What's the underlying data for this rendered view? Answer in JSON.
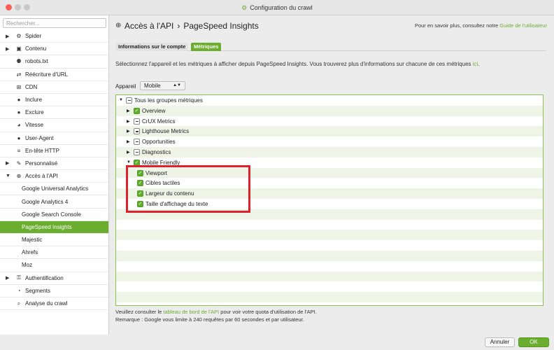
{
  "window": {
    "title": "Configuration du crawl"
  },
  "sidebar": {
    "search_placeholder": "Rechercher...",
    "items": [
      {
        "label": "Spider",
        "caret": "▶",
        "icon": "⚙"
      },
      {
        "label": "Contenu",
        "caret": "▶",
        "icon": "▣"
      },
      {
        "label": "robots.txt",
        "caret": "",
        "icon": "⚉"
      },
      {
        "label": "Réécriture d'URL",
        "caret": "",
        "icon": "⇄"
      },
      {
        "label": "CDN",
        "caret": "",
        "icon": "⊞"
      },
      {
        "label": "Inclure",
        "caret": "",
        "icon": "●"
      },
      {
        "label": "Exclure",
        "caret": "",
        "icon": "●"
      },
      {
        "label": "Vitesse",
        "caret": "",
        "icon": "◕"
      },
      {
        "label": "User-Agent",
        "caret": "",
        "icon": "●"
      },
      {
        "label": "En-tête HTTP",
        "caret": "",
        "icon": "≡"
      },
      {
        "label": "Personnalisé",
        "caret": "▶",
        "icon": "✎"
      },
      {
        "label": "Accès à l'API",
        "caret": "▼",
        "icon": "⊕"
      },
      {
        "label": "Google Universal Analytics",
        "child": true
      },
      {
        "label": "Google Analytics 4",
        "child": true
      },
      {
        "label": "Google Search Console",
        "child": true
      },
      {
        "label": "PageSpeed Insights",
        "child": true,
        "active": true
      },
      {
        "label": "Majestic",
        "child": true
      },
      {
        "label": "Ahrefs",
        "child": true
      },
      {
        "label": "Moz",
        "child": true
      },
      {
        "label": "Authentification",
        "caret": "▶",
        "icon": "⚿"
      },
      {
        "label": "Segments",
        "caret": "",
        "icon": "◔"
      },
      {
        "label": "Analyse du crawl",
        "caret": "",
        "icon": "⌕"
      }
    ]
  },
  "header": {
    "breadcrumb": [
      "Accès à l'API",
      "PageSpeed Insights"
    ],
    "separator": "›",
    "help_text": "Pour en savoir plus, consultez notre ",
    "help_link": "Guide de l'utilisateur"
  },
  "tabs": [
    {
      "label": "Informations sur le compte"
    },
    {
      "label": "Métriques",
      "active": true
    }
  ],
  "description": {
    "text": "Sélectionnez l'appareil et les métriques à afficher depuis PageSpeed Insights. Vous trouverez plus d'informations sur chacune de ces métriques ",
    "link": "ici",
    "suffix": "."
  },
  "device": {
    "label": "Appareil",
    "value": "Mobile"
  },
  "tree": [
    {
      "label": "Tous les groupes métriques",
      "level": 0,
      "caret": "▼",
      "state": "partial"
    },
    {
      "label": "Overview",
      "level": 1,
      "caret": "▶",
      "state": "checked"
    },
    {
      "label": "CrUX Metrics",
      "level": 1,
      "caret": "▶",
      "state": "partial"
    },
    {
      "label": "Lighthouse Metrics",
      "level": 1,
      "caret": "▶",
      "state": "partial"
    },
    {
      "label": "Opportunities",
      "level": 1,
      "caret": "▶",
      "state": "partial"
    },
    {
      "label": "Diagnostics",
      "level": 1,
      "caret": "▶",
      "state": "partial"
    },
    {
      "label": "Mobile Friendly",
      "level": 1,
      "caret": "▼",
      "state": "checked"
    },
    {
      "label": "Viewport",
      "level": 2,
      "caret": "",
      "state": "checked"
    },
    {
      "label": "Cibles tactiles",
      "level": 2,
      "caret": "",
      "state": "checked"
    },
    {
      "label": "Largeur du contenu",
      "level": 2,
      "caret": "",
      "state": "checked"
    },
    {
      "label": "Taille d'affichage du texte",
      "level": 2,
      "caret": "",
      "state": "checked"
    }
  ],
  "footer": {
    "line1_before": "Veuillez consulter le ",
    "line1_link": "tableau de bord de l'API",
    "line1_after": " pour voir votre quota d'utilisation de l'API.",
    "line2": "Remarque : Google vous limite à 240 requêtes par 60 secondes et par utilisateur."
  },
  "buttons": {
    "cancel": "Annuler",
    "ok": "OK"
  },
  "colors": {
    "accent": "#6aad2f",
    "highlight_box": "#e0202a"
  }
}
